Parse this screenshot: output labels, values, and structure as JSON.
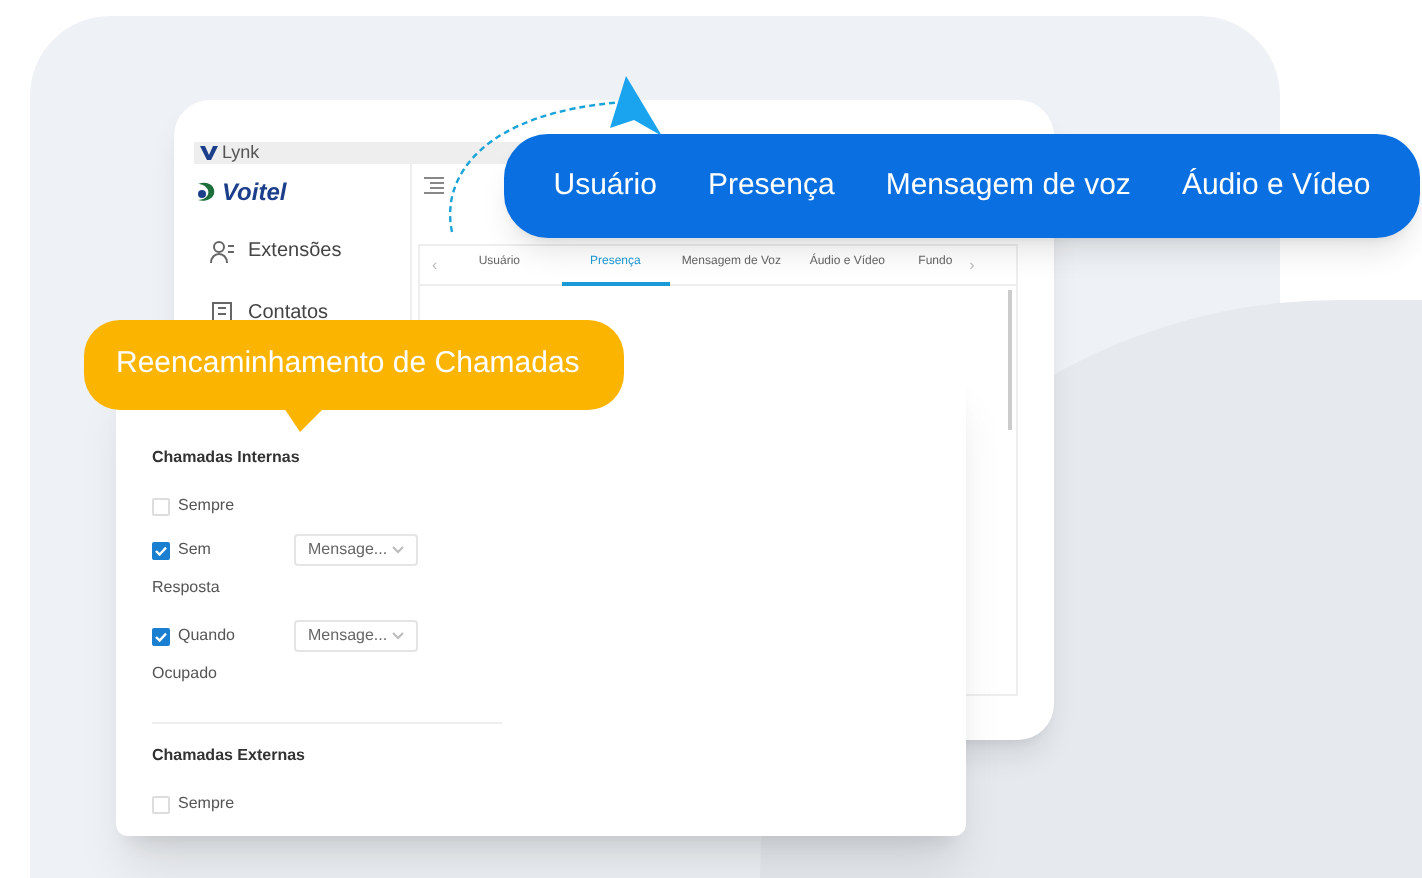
{
  "window": {
    "title": "Lynk"
  },
  "logo": {
    "text": "Voitel"
  },
  "sidebar": {
    "items": [
      {
        "label": "Extensões"
      },
      {
        "label": "Contatos"
      }
    ]
  },
  "tabs": {
    "prev": "‹",
    "next": "›",
    "items": [
      {
        "label": "Usuário",
        "selected": false
      },
      {
        "label": "Presença",
        "selected": true
      },
      {
        "label": "Mensagem de Voz",
        "selected": false
      },
      {
        "label": "Áudio e Vídeo",
        "selected": false
      },
      {
        "label": "Fundo",
        "selected": false
      }
    ]
  },
  "highlight_tabs": [
    "Usuário",
    "Presença",
    "Mensagem de voz",
    "Áudio e Vídeo"
  ],
  "callout": "Reencaminhamento de Chamadas",
  "forwarding": {
    "sections": [
      {
        "title": "Chamadas Internas",
        "options": [
          {
            "label": "Sempre",
            "checked": false
          },
          {
            "label": "Sem",
            "sublabel": "Resposta",
            "checked": true,
            "select": "Mensage..."
          },
          {
            "label": "Quando",
            "sublabel": "Ocupado",
            "checked": true,
            "select": "Mensage..."
          }
        ]
      },
      {
        "title": "Chamadas Externas",
        "options": [
          {
            "label": "Sempre",
            "checked": false
          }
        ]
      }
    ]
  }
}
